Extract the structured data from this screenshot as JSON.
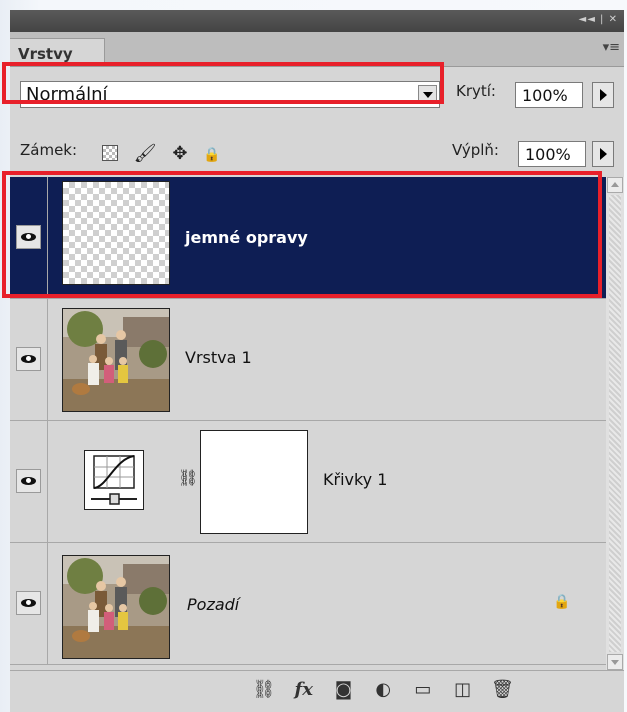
{
  "panel": {
    "tab_label": "Vrstvy",
    "window_controls": "◄◄ | ✕",
    "menu_glyph": "▾≡"
  },
  "blend": {
    "mode": "Normální"
  },
  "opacity": {
    "label": "Krytí:",
    "value": "100%"
  },
  "fill": {
    "label": "Výplň:",
    "value": "100%"
  },
  "lock": {
    "label": "Zámek:"
  },
  "layers": [
    {
      "name": "jemné opravy",
      "selected": true,
      "visible": true,
      "thumbnail": "transparent"
    },
    {
      "name": "Vrstva 1",
      "selected": false,
      "visible": true,
      "thumbnail": "photo"
    },
    {
      "name": "Křivky 1",
      "selected": false,
      "visible": true,
      "thumbnail": "curves-adjustment"
    },
    {
      "name": "Pozadí",
      "selected": false,
      "visible": true,
      "thumbnail": "photo",
      "locked": true
    }
  ],
  "colors": {
    "selection": "#0e1e54",
    "highlight": "#e8202a"
  },
  "bottom_icons": [
    "link-icon",
    "fx-icon",
    "mask-icon",
    "adjustment-icon",
    "folder-icon",
    "new-layer-icon",
    "trash-icon"
  ]
}
